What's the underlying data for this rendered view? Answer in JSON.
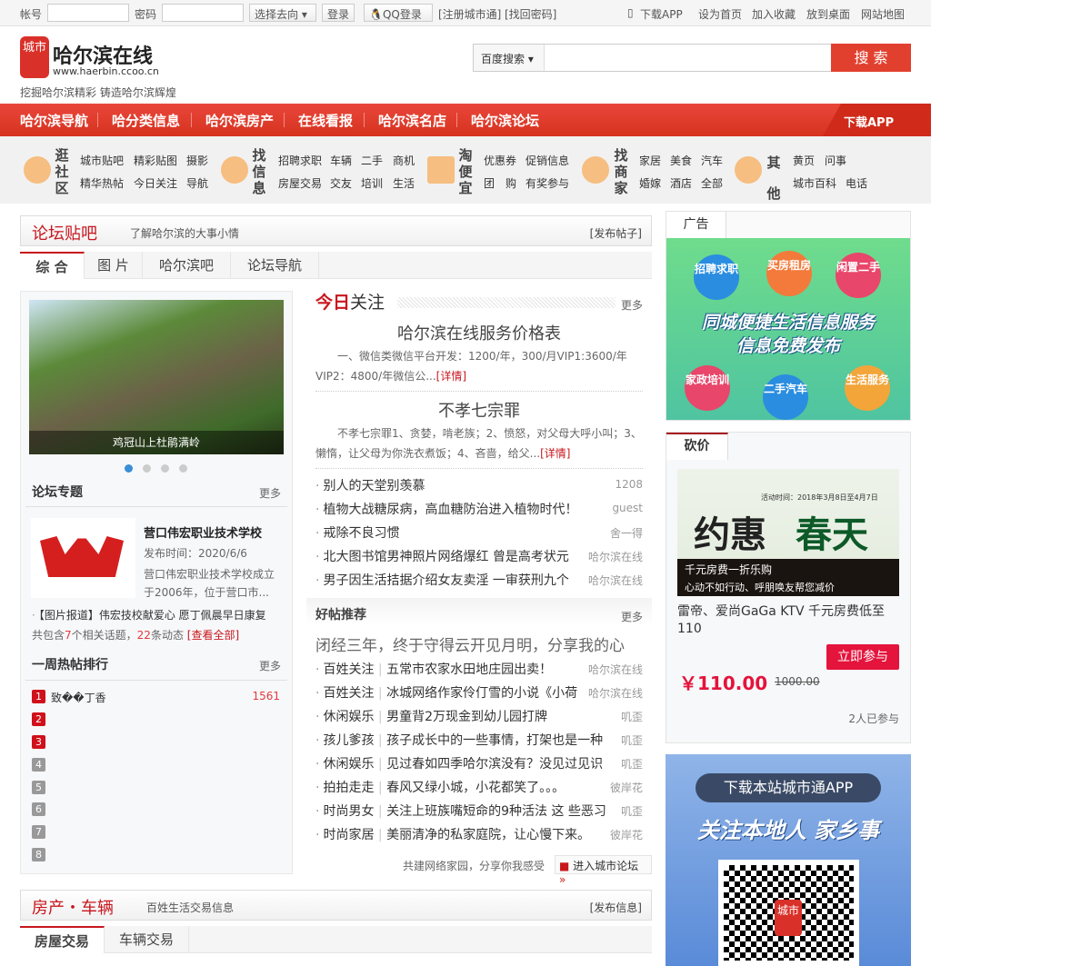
{
  "topbar": {
    "account_label": "帐号",
    "password_label": "密码",
    "direction_select": "选择去向",
    "login": "登录",
    "qq_login": "QQ登录",
    "register": "[注册城市通]",
    "recover": "[找回密码]",
    "links": [
      "下载APP",
      "设为首页",
      "加入收藏",
      "放到桌面",
      "网站地图"
    ]
  },
  "header": {
    "logo_chars": "城市",
    "site_name": "哈尔滨在线",
    "url": "www.haerbin.ccoo.cn",
    "slogan": "挖掘哈尔滨精彩 铸造哈尔滨辉煌",
    "search_engine": "百度搜索",
    "search_button": "搜 索",
    "search_placeholder": ""
  },
  "nav": {
    "items": [
      "哈尔滨导航",
      "哈分类信息",
      "哈尔滨房产",
      "在线看报",
      "哈尔滨名店",
      "哈尔滨论坛"
    ],
    "download": "下载APP"
  },
  "subnav": [
    {
      "title": "逛社区",
      "rows": [
        [
          "城市贴吧",
          "精彩贴图",
          "摄影"
        ],
        [
          "精华热帖",
          "今日关注",
          "导航"
        ]
      ]
    },
    {
      "title": "找信息",
      "rows": [
        [
          "招聘求职",
          "车辆",
          "二手",
          "商机"
        ],
        [
          "房屋交易",
          "交友",
          "培训",
          "生活"
        ]
      ]
    },
    {
      "title": "淘便宜",
      "rows": [
        [
          "优惠券",
          "促销信息"
        ],
        [
          "团　购",
          "有奖参与"
        ]
      ]
    },
    {
      "title": "找商家",
      "rows": [
        [
          "家居",
          "美食",
          "汽车"
        ],
        [
          "婚嫁",
          "酒店",
          "全部"
        ]
      ]
    },
    {
      "title": "其他",
      "rows": [
        [
          "黄页",
          "问事"
        ],
        [
          "城市百科",
          "电话"
        ]
      ]
    }
  ],
  "forum": {
    "title": "论坛贴吧",
    "subtitle": "了解哈尔滨的大事小情",
    "post": "[发布帖子]",
    "tabs": [
      "综 合",
      "图 片",
      "哈尔滨吧",
      "论坛导航"
    ],
    "slide_caption": "鸡冠山上杜鹃满岭",
    "topic": {
      "title": "论坛专题",
      "more": "更多",
      "name": "营口伟宏职业技术学校",
      "date": "发布时间：2020/6/6",
      "desc": "营口伟宏职业技术学校成立于2006年，位于营口市...",
      "report": "【图片报道】伟宏技校献爱心 愿丁佩晨早日康复",
      "count_pre": "共包含",
      "topics": "7",
      "count_mid": "个相关话题，",
      "dyn": "22",
      "count_post": "条动态",
      "view_all": "[查看全部]"
    },
    "weekly": {
      "title": "一周热帖排行",
      "more": "更多",
      "items": [
        {
          "rank": "1",
          "title": "致��丁香",
          "count": "1561"
        },
        {
          "rank": "2"
        },
        {
          "rank": "3"
        },
        {
          "rank": "4"
        },
        {
          "rank": "5"
        },
        {
          "rank": "6"
        },
        {
          "rank": "7"
        },
        {
          "rank": "8"
        }
      ]
    },
    "today": {
      "title_red": "今日",
      "title": "关注",
      "more": "更多",
      "articles": [
        {
          "headline": "哈尔滨在线服务价格表",
          "summary": "一、微信类微信平台开发：1200/年，300/月VIP1:3600/年VIP2：4800/年微信公...",
          "detail": "[详情]"
        },
        {
          "headline": "不孝七宗罪",
          "summary": "不孝七宗罪1、贪婪，啃老族；2、愤怒，对父母大呼小叫；3、懒惰，让父母为你洗衣煮饭；4、吝啬，给父...",
          "detail": "[详情]"
        }
      ],
      "list": [
        {
          "title": "别人的天堂别羡慕",
          "author": "1208"
        },
        {
          "title": "植物大战糖尿病，高血糖防治进入植物时代！",
          "author": "guest"
        },
        {
          "title": "戒除不良习惯",
          "author": "舍一得"
        },
        {
          "title": "北大图书馆男神照片网络爆红 曾是高考状元",
          "author": "哈尔滨在线"
        },
        {
          "title": "男子因生活拮据介绍女友卖淫 一审获刑九个",
          "author": "哈尔滨在线"
        }
      ]
    },
    "good": {
      "title": "好帖推荐",
      "more": "更多",
      "headline": "闭经三年，终于守得云开见月明，分享我的心",
      "list": [
        {
          "cat": "百姓关注",
          "title": "五常市农家水田地庄园出卖！",
          "author": "哈尔滨在线"
        },
        {
          "cat": "百姓关注",
          "title": "冰城网络作家伶仃雪的小说《小荷",
          "author": "哈尔滨在线"
        },
        {
          "cat": "休闲娱乐",
          "title": "男童背2万现金到幼儿园打牌",
          "author": "叽歪"
        },
        {
          "cat": "孩儿爹孩",
          "title": "孩子成长中的一些事情，打架也是一种",
          "author": "叽歪"
        },
        {
          "cat": "休闲娱乐",
          "title": "见过春如四季哈尔滨没有？没见过见识",
          "author": "叽歪"
        },
        {
          "cat": "拍拍走走",
          "title": "春风又绿小城，小花都笑了。。。",
          "author": "彼岸花"
        },
        {
          "cat": "时尚男女",
          "title": "关注上班族嘴短命的9种活法 这 些恶习",
          "author": "叽歪"
        },
        {
          "cat": "时尚家居",
          "title": "美丽清净的私家庭院，让心慢下来。",
          "author": "彼岸花"
        }
      ]
    },
    "footer_text": "共建网络家园，分享你我感受",
    "enter": "进入城市论坛"
  },
  "house": {
    "title": "房产・车辆",
    "subtitle": "百姓生活交易信息",
    "post": "[发布信息]",
    "tabs": [
      "房屋交易",
      "车辆交易"
    ]
  },
  "ad": {
    "title": "广告",
    "bubbles": [
      "招聘求职",
      "买房租房",
      "闲置二手",
      "家政培训",
      "二手汽车",
      "生活服务"
    ],
    "line1": "同城便捷生活信息服务",
    "line2": "信息免费发布"
  },
  "bargain": {
    "tab": "砍价",
    "banner_date": "活动时间：2018年3月8日至4月7日",
    "banner_big1": "约惠",
    "banner_big2": "春天",
    "banner_l1": "千元房费一折乐购",
    "banner_l2": "心动不如行动、呼朋唤友帮您减价",
    "title": "雷帝、爱尚GaGa KTV 千元房费低至110",
    "join": "立即参与",
    "price": "￥110.00",
    "orig": "1000.00",
    "joined": "2人已参与"
  },
  "app": {
    "button": "下载本站城市通APP",
    "slogan": "关注本地人 家乡事",
    "qr_logo": "城市"
  },
  "colors": {
    "brand": "#d9312a",
    "price": "#e4143c"
  }
}
